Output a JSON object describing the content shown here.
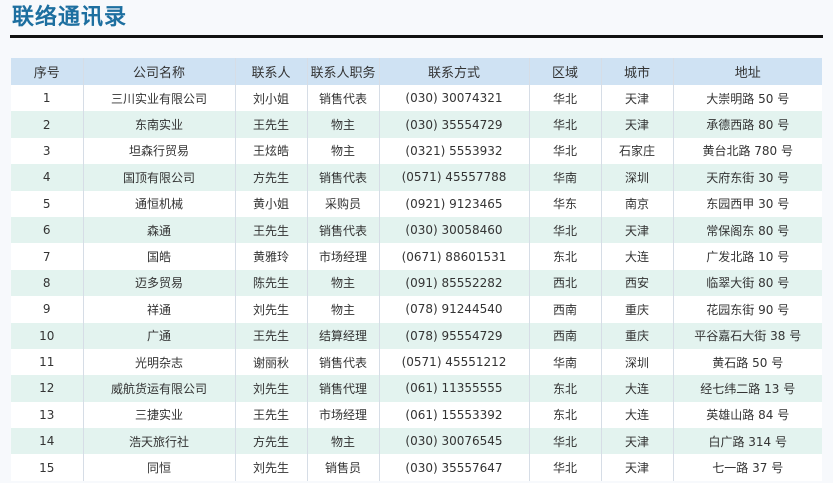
{
  "page": {
    "title": "联络通讯录"
  },
  "table": {
    "headers": [
      "序号",
      "公司名称",
      "联系人",
      "联系人职务",
      "联系方式",
      "区域",
      "城市",
      "地址"
    ],
    "rows": [
      [
        "1",
        "三川实业有限公司",
        "刘小姐",
        "销售代表",
        "(030) 30074321",
        "华北",
        "天津",
        "大崇明路 50 号"
      ],
      [
        "2",
        "东南实业",
        "王先生",
        "物主",
        "(030) 35554729",
        "华北",
        "天津",
        "承德西路 80 号"
      ],
      [
        "3",
        "坦森行贸易",
        "王炫皓",
        "物主",
        "(0321) 5553932",
        "华北",
        "石家庄",
        "黄台北路 780 号"
      ],
      [
        "4",
        "国顶有限公司",
        "方先生",
        "销售代表",
        "(0571) 45557788",
        "华南",
        "深圳",
        "天府东街 30 号"
      ],
      [
        "5",
        "通恒机械",
        "黄小姐",
        "采购员",
        "(0921) 9123465",
        "华东",
        "南京",
        "东园西甲 30 号"
      ],
      [
        "6",
        "森通",
        "王先生",
        "销售代表",
        "(030) 30058460",
        "华北",
        "天津",
        "常保阁东 80 号"
      ],
      [
        "7",
        "国皓",
        "黄雅玲",
        "市场经理",
        "(0671) 88601531",
        "东北",
        "大连",
        "广发北路 10 号"
      ],
      [
        "8",
        "迈多贸易",
        "陈先生",
        "物主",
        "(091) 85552282",
        "西北",
        "西安",
        "临翠大街 80 号"
      ],
      [
        "9",
        "祥通",
        "刘先生",
        "物主",
        "(078) 91244540",
        "西南",
        "重庆",
        "花园东街 90 号"
      ],
      [
        "10",
        "广通",
        "王先生",
        "结算经理",
        "(078) 95554729",
        "西南",
        "重庆",
        "平谷嘉石大街 38 号"
      ],
      [
        "11",
        "光明杂志",
        "谢丽秋",
        "销售代表",
        "(0571) 45551212",
        "华南",
        "深圳",
        "黄石路 50 号"
      ],
      [
        "12",
        "威航货运有限公司",
        "刘先生",
        "销售代理",
        "(061) 11355555",
        "东北",
        "大连",
        "经七纬二路 13 号"
      ],
      [
        "13",
        "三捷实业",
        "王先生",
        "市场经理",
        "(061) 15553392",
        "东北",
        "大连",
        "英雄山路 84 号"
      ],
      [
        "14",
        "浩天旅行社",
        "方先生",
        "物主",
        "(030) 30076545",
        "华北",
        "天津",
        "白广路 314 号"
      ],
      [
        "15",
        "同恒",
        "刘先生",
        "销售员",
        "(030) 35557647",
        "华北",
        "天津",
        "七一路 37 号"
      ]
    ]
  }
}
